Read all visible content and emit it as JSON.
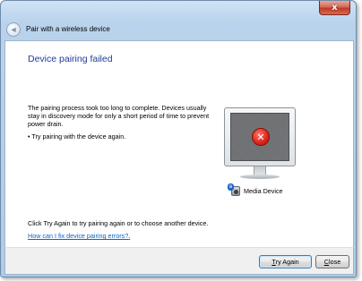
{
  "window": {
    "title": "Pair with a wireless device",
    "close_glyph": "x"
  },
  "header": {
    "back_icon": "back-arrow-icon",
    "back_glyph": "◄"
  },
  "content": {
    "heading": "Device pairing failed",
    "description": "The pairing process took too long to complete. Devices usually stay in discovery mode for only a short period of time to prevent power drain.",
    "bullet": "• Try pairing with the device again.",
    "device_label": "Media Device",
    "error_icon": "error-x-icon",
    "error_glyph": "✕",
    "bluetooth_glyph": "ʙ",
    "try_again_text": "Click Try Again to try pairing again or to choose another device.",
    "help_link": "How can I fix device pairing errors?",
    "help_link_end": "."
  },
  "footer": {
    "try_again_prefix": "",
    "try_again_underline": "T",
    "try_again_rest": "ry Again",
    "close_prefix": "",
    "close_underline": "C",
    "close_rest": "lose"
  },
  "colors": {
    "heading": "#1e3a9a",
    "link": "#0b63c4",
    "close_button": "#c0392b",
    "error": "#e0281c"
  }
}
